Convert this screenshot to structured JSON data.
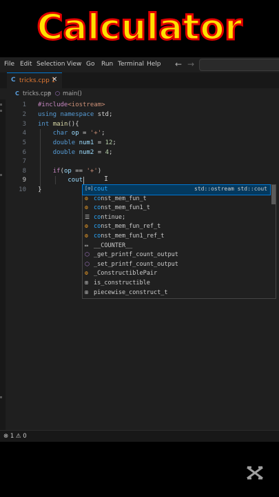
{
  "banner": {
    "title": "Calculator"
  },
  "menubar": {
    "items": [
      "File",
      "Edit",
      "Selection",
      "View",
      "Go",
      "Run",
      "Terminal",
      "Help"
    ],
    "back": "←",
    "forward": "→"
  },
  "tab": {
    "icon": "C",
    "label": "tricks.cpp 1",
    "close": "✕"
  },
  "breadcrumb": {
    "file_icon": "C",
    "file": "tricks.cpp",
    "sep": "›",
    "func_icon": "⬡",
    "func": "main()"
  },
  "editor": {
    "line_numbers": [
      "1",
      "2",
      "3",
      "4",
      "5",
      "6",
      "7",
      "8",
      "9",
      "10"
    ],
    "current_line": "9"
  },
  "suggest": {
    "items": [
      {
        "icon": "[⊙]",
        "label_match": "cout",
        "label_rest": "",
        "detail": "std::ostream std::cout"
      },
      {
        "icon": "⚙",
        "label_match": "co",
        "label_rest": "nst_mem_fun_t",
        "detail": ""
      },
      {
        "icon": "⚙",
        "label_match": "co",
        "label_rest": "nst_mem_fun1_t",
        "detail": ""
      },
      {
        "icon": "☰",
        "label_match": "co",
        "label_rest": "ntinue;",
        "detail": ""
      },
      {
        "icon": "⚙",
        "label_match": "co",
        "label_rest": "nst_mem_fun_ref_t",
        "detail": ""
      },
      {
        "icon": "⚙",
        "label_match": "co",
        "label_rest": "nst_mem_fun1_ref_t",
        "detail": ""
      },
      {
        "icon": "▭",
        "label_match": "",
        "label_rest": "__COUNTER__",
        "detail": ""
      },
      {
        "icon": "⬡",
        "label_match": "",
        "label_rest": "_get_printf_count_output",
        "detail": ""
      },
      {
        "icon": "⬡",
        "label_match": "",
        "label_rest": "_set_printf_count_output",
        "detail": ""
      },
      {
        "icon": "⚙",
        "label_match": "",
        "label_rest": "_ConstructiblePair",
        "detail": ""
      },
      {
        "icon": "⊞",
        "label_match": "",
        "label_rest": "is_constructible",
        "detail": ""
      },
      {
        "icon": "⊞",
        "label_match": "",
        "label_rest": "piecewise_construct_t",
        "detail": ""
      }
    ]
  },
  "status": {
    "errors": "⊗ 1 ⚠ 0"
  },
  "watermark": {
    "icon": "capcut-icon"
  }
}
